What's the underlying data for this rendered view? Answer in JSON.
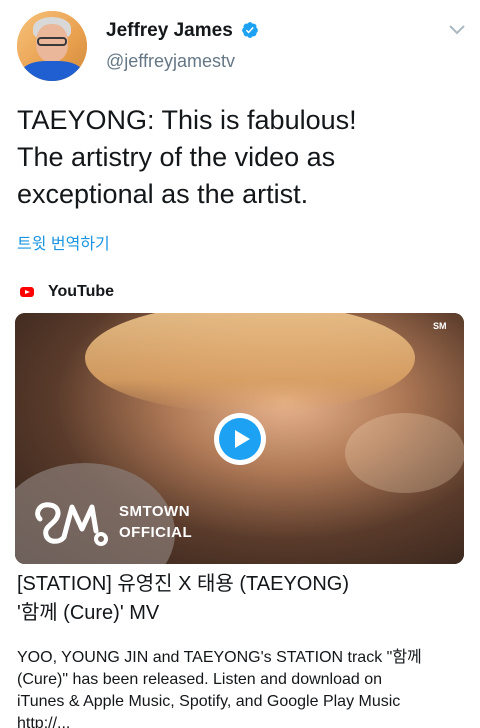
{
  "user": {
    "name": "Jeffrey James",
    "handle": "@jeffreyjamestv",
    "verified_color": "#1da1f2"
  },
  "tweet": {
    "text_lines": [
      "TAEYONG: This is fabulous!",
      "The artistry of the video as",
      "exceptional as the artist."
    ],
    "translate_label": "트윗 번역하기"
  },
  "card": {
    "source": "YouTube",
    "video": {
      "brand_line1": "SMTOWN",
      "brand_line2": "OFFICIAL",
      "corner_mark": "SM"
    },
    "title_lines": [
      "[STATION] 유영진 X 태용 (TAEYONG)",
      "'함께 (Cure)' MV"
    ],
    "description_lines": [
      "YOO, YOUNG JIN and TAEYONG's STATION track \"함께",
      "(Cure)\" has been released. Listen and download on",
      "iTunes & Apple Music, Spotify, and Google Play Music",
      "http://..."
    ]
  },
  "colors": {
    "link": "#1b95e0",
    "text": "#14171a",
    "secondary": "#657786",
    "youtube_red": "#ff0000"
  }
}
